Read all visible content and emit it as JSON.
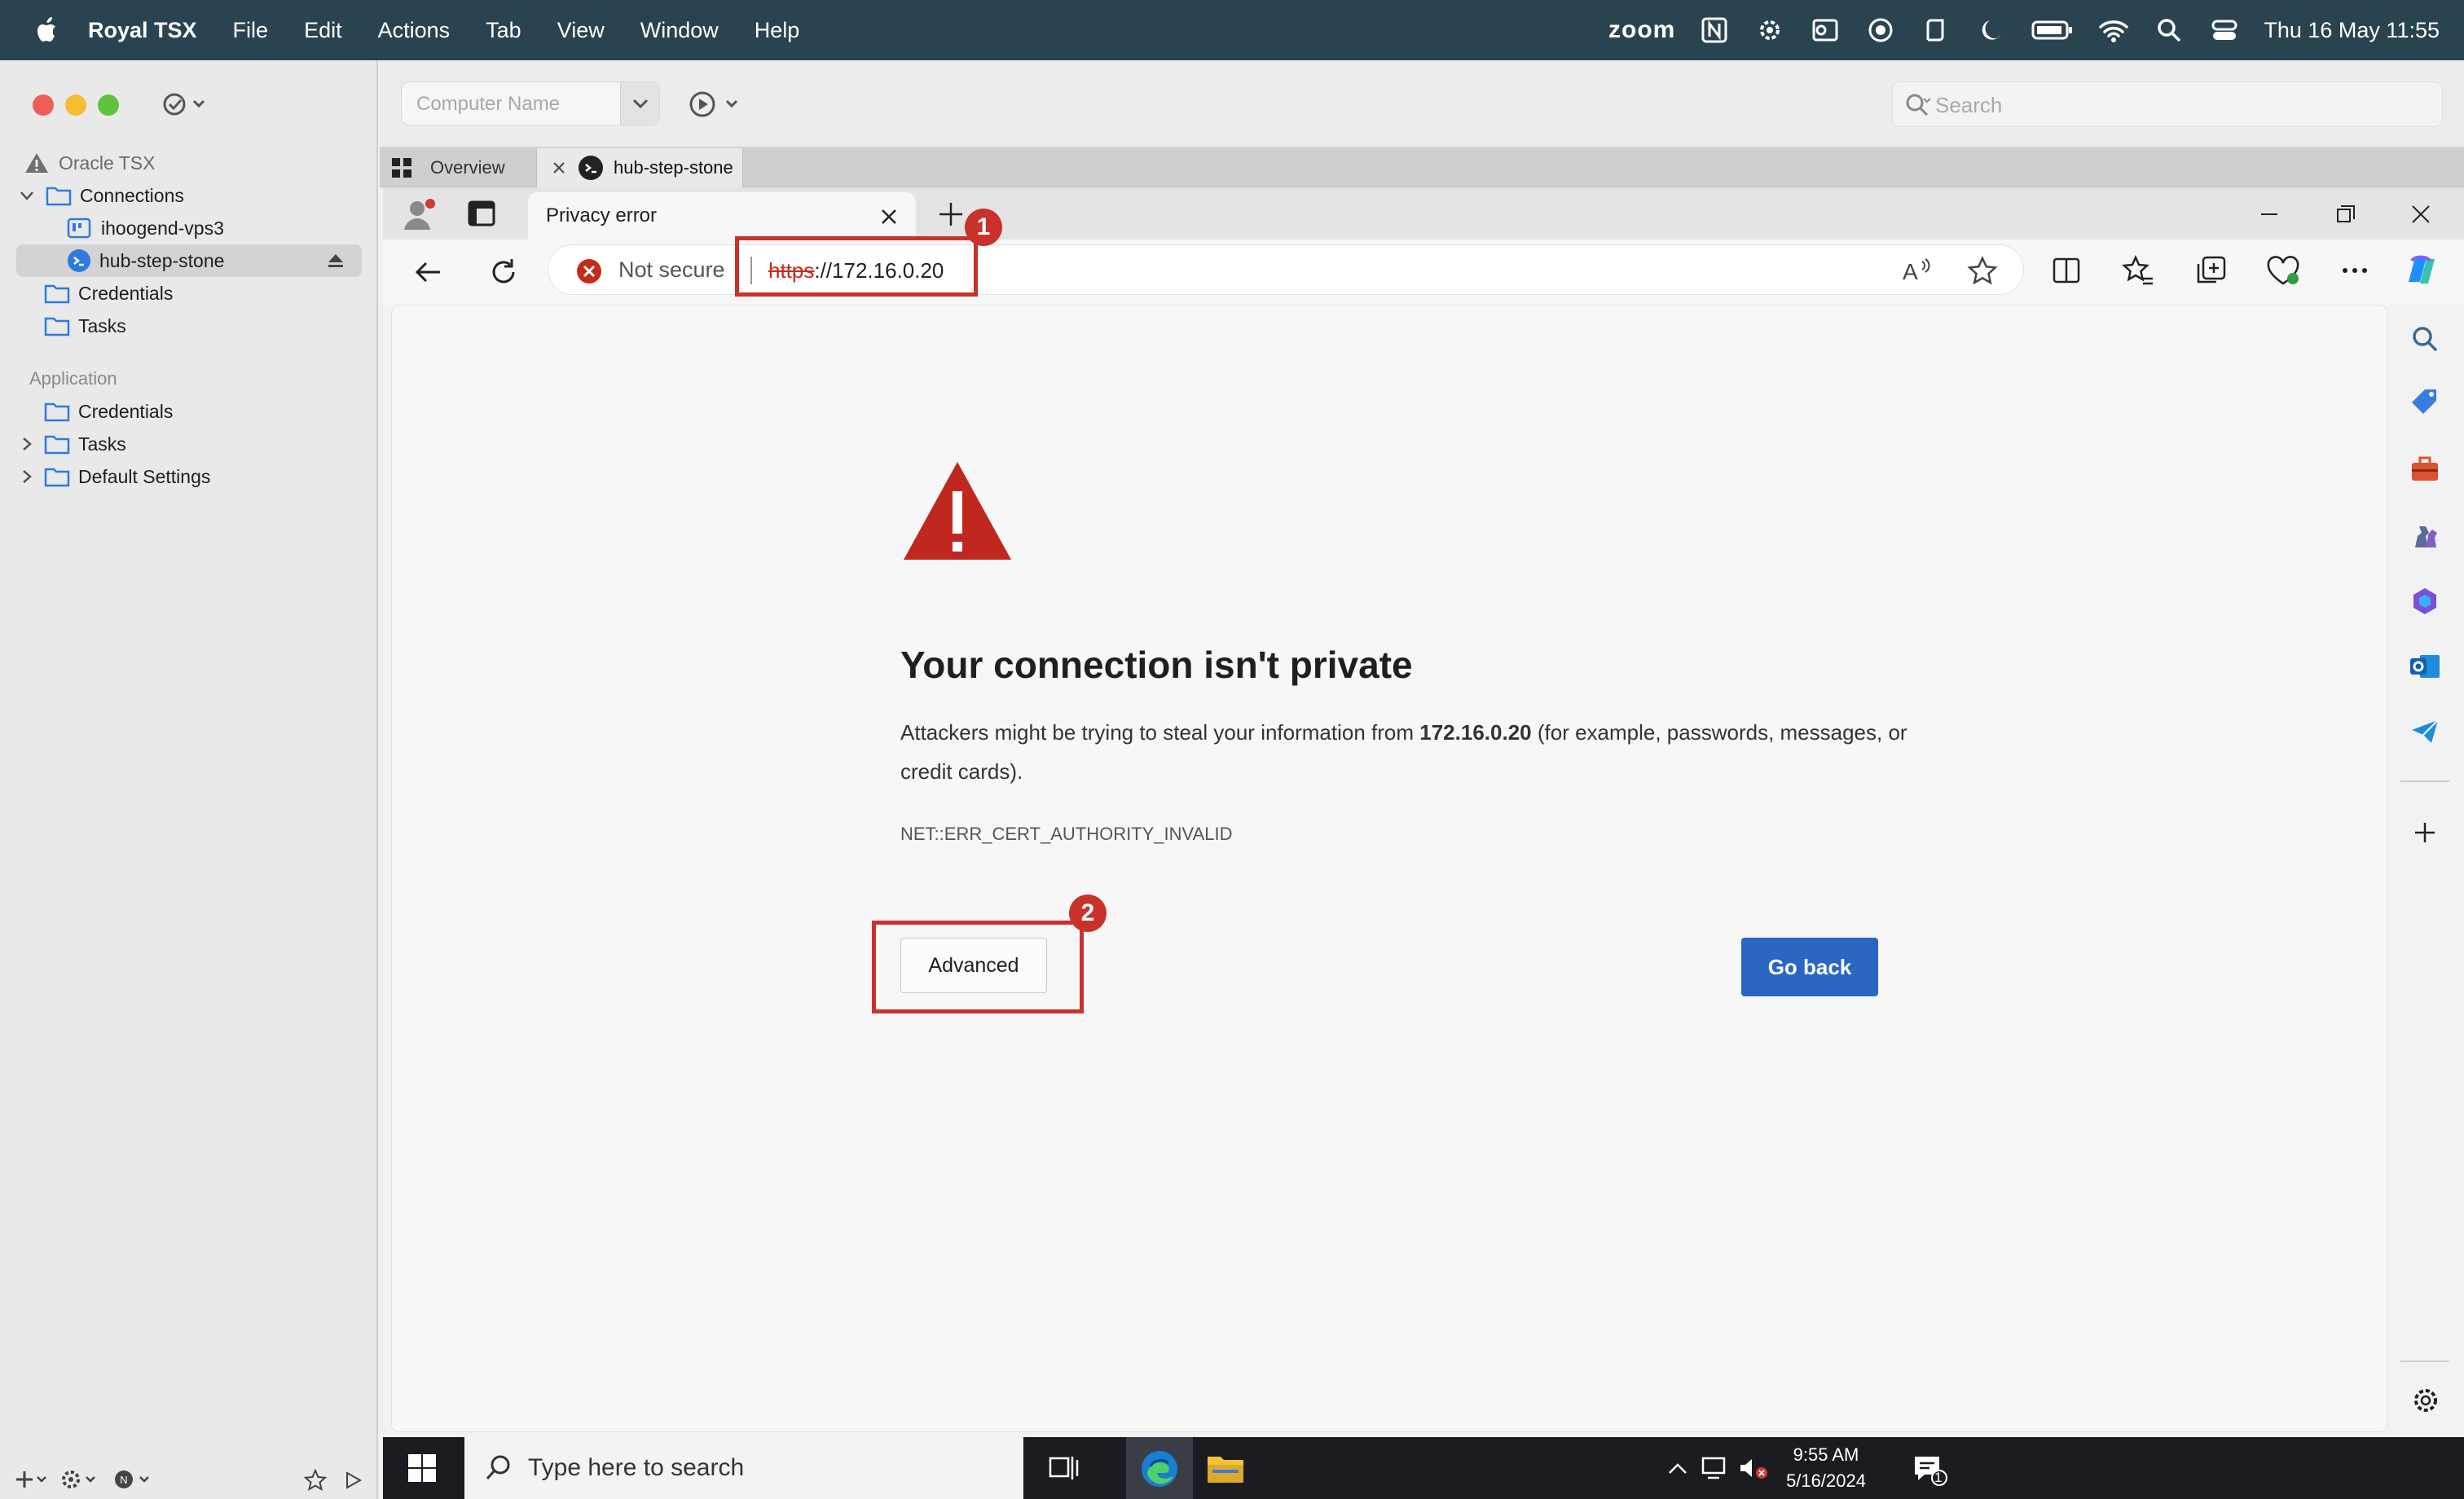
{
  "menubar": {
    "app_name": "Royal TSX",
    "items": [
      "File",
      "Edit",
      "Actions",
      "Tab",
      "View",
      "Window",
      "Help"
    ],
    "zoom": "zoom",
    "clock": "Thu 16 May  11:55"
  },
  "sidebar": {
    "root": "Oracle TSX",
    "connections": "Connections",
    "conn_items": [
      "ihoogend-vps3",
      "hub-step-stone"
    ],
    "credentials": "Credentials",
    "tasks": "Tasks",
    "app_header": "Application",
    "app_items": [
      "Credentials",
      "Tasks",
      "Default Settings"
    ]
  },
  "toolbar": {
    "computer_name_placeholder": "Computer Name",
    "search_placeholder": "Search"
  },
  "royal_tabs": {
    "overview": "Overview",
    "active": "hub-step-stone"
  },
  "edge": {
    "tab_title": "Privacy error",
    "not_secure": "Not secure",
    "url_scheme": "https",
    "url_rest": "://172.16.0.20"
  },
  "error_page": {
    "title": "Your connection isn't private",
    "body_pre": "Attackers might be trying to steal your information from ",
    "host": "172.16.0.20",
    "body_post": " (for example, passwords, messages, or credit cards).",
    "code": "NET::ERR_CERT_AUTHORITY_INVALID",
    "advanced": "Advanced",
    "go_back": "Go back"
  },
  "callouts": {
    "one": "1",
    "two": "2"
  },
  "taskbar": {
    "search_placeholder": "Type here to search",
    "time": "9:55 AM",
    "date": "5/16/2024",
    "notif_count": "1"
  },
  "colors": {
    "accent": "#2a66c2",
    "callout": "#c9312b",
    "warning": "#c0281f"
  }
}
